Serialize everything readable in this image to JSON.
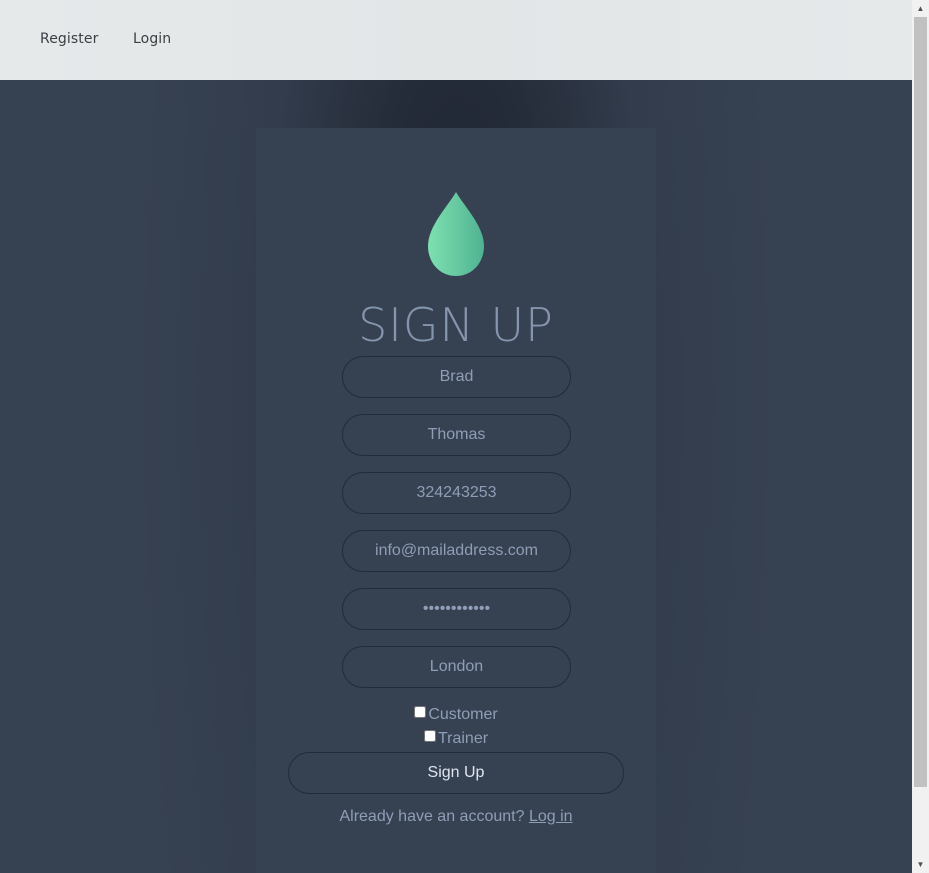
{
  "nav": {
    "register_label": "Register",
    "login_label": "Login"
  },
  "form": {
    "title": "SIGN UP",
    "first_name": "Brad",
    "last_name": "Thomas",
    "phone": "324243253",
    "email": "info@mailaddress.com",
    "password": "••••••••••••",
    "city": "London",
    "customer_label": "Customer",
    "trainer_label": "Trainer",
    "submit_label": "Sign Up",
    "footer_text": "Already have an account?",
    "footer_link": "Log in"
  },
  "colors": {
    "background": "#364152",
    "accent_gradient_start": "#7ee0b0",
    "accent_gradient_end": "#4fb392"
  }
}
